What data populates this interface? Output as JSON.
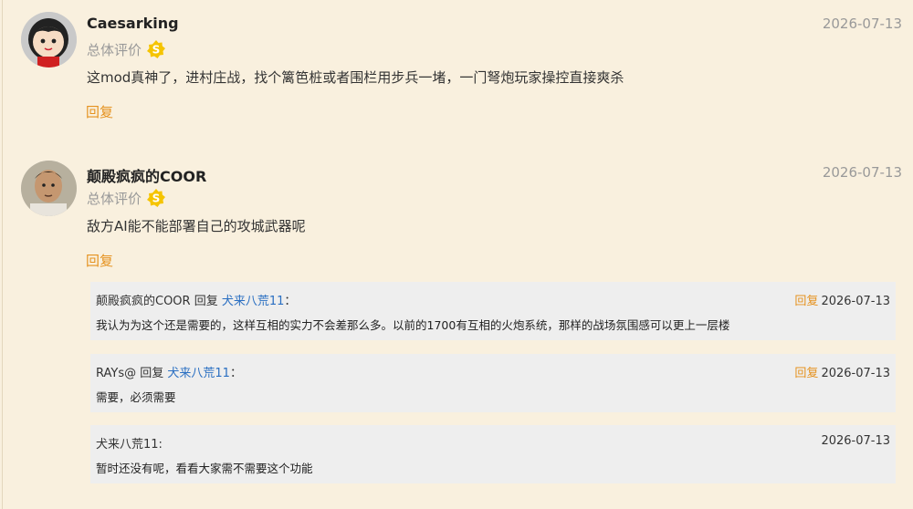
{
  "comments": [
    {
      "author": "Caesarking",
      "date": "2026-07-13",
      "rating_label": "总体评价",
      "rating_badge": "S",
      "text": "这mod真神了，进村庄战，找个篱笆桩或者围栏用步兵一堵，一门弩炮玩家操控直接爽杀",
      "reply_label": "回复"
    },
    {
      "author": "颠殿疯疯的COOR",
      "date": "2026-07-13",
      "rating_label": "总体评价",
      "rating_badge": "S",
      "text": "敌方AI能不能部署自己的攻城武器呢",
      "reply_label": "回复",
      "replies": [
        {
          "author": "颠殿疯疯的COOR",
          "action": "回复",
          "to": "犬来八荒11",
          "colon": "：",
          "reply_label": "回复",
          "date": "2026-07-13",
          "text": "我认为为这个还是需要的，这样互相的实力不会差那么多。以前的1700有互相的火炮系统，那样的战场氛围感可以更上一层楼"
        },
        {
          "author": "RAYs@",
          "action": "回复",
          "to": "犬来八荒11",
          "colon": "：",
          "reply_label": "回复",
          "date": "2026-07-13",
          "text": "需要，必须需要"
        },
        {
          "author": "犬来八荒11:",
          "date": "2026-07-13",
          "text": "暂时还没有呢，看看大家需不需要这个功能"
        }
      ]
    }
  ],
  "colors": {
    "accent": "#e5921f",
    "link": "#2a6fc2",
    "background": "#f9f0de",
    "badge": "#f5c400"
  }
}
